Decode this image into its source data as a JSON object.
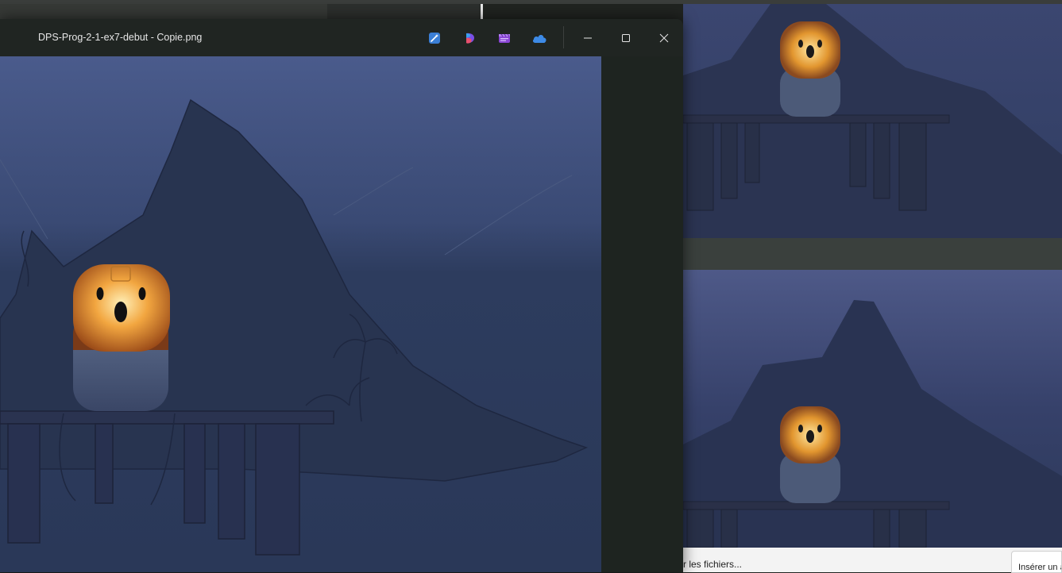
{
  "viewer": {
    "title": "DPS-Prog-2-1-ex7-debut - Copie.png",
    "toolbar": [
      {
        "name": "edit-image-button",
        "icon": "magic-pen-icon"
      },
      {
        "name": "designer-button",
        "icon": "designer-icon"
      },
      {
        "name": "clipchamp-button",
        "icon": "clipchamp-icon"
      },
      {
        "name": "onedrive-button",
        "icon": "cloud-icon"
      }
    ],
    "window_controls": [
      "minimize",
      "maximize",
      "close"
    ]
  },
  "background_app": {
    "status_text": "r les fichiers...",
    "insert_button": "Insérer un a"
  },
  "colors": {
    "sky_top": "#48598a",
    "sky_bottom": "#2a3a5c",
    "mountain": "#283450",
    "lantern_glow": "#f2a640",
    "window_bg": "#202522"
  }
}
